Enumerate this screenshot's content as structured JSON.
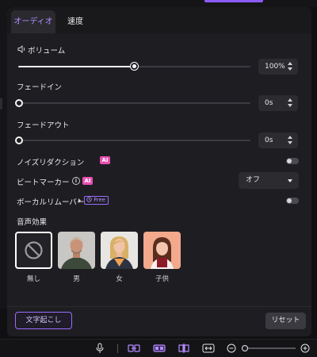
{
  "tabs": [
    {
      "label": "オーディオ",
      "active": true
    },
    {
      "label": "速度",
      "active": false
    }
  ],
  "volume": {
    "label": "ボリューム",
    "icon": "speaker-icon",
    "value": "100%",
    "level": 0.5
  },
  "fade_in": {
    "label": "フェードイン",
    "value": "0s",
    "level": 0.0
  },
  "fade_out": {
    "label": "フェードアウト",
    "value": "0s",
    "level": 0.0
  },
  "noise_reduction": {
    "label": "ノイズリダクション",
    "badge": "AI",
    "enabled": false
  },
  "beat_marker": {
    "label": "ビートマーカー",
    "badge": "AI",
    "info_icon": "info-icon",
    "select_value": "オフ"
  },
  "vocal_remover": {
    "label": "ボーカルリムーバー",
    "badge": "Free",
    "enabled": false
  },
  "voice_effects": {
    "title": "音声効果",
    "items": [
      {
        "label": "無し",
        "icon": "none-icon",
        "selected": true
      },
      {
        "label": "男",
        "icon": "man-portrait",
        "selected": false
      },
      {
        "label": "女",
        "icon": "woman-portrait",
        "selected": false
      },
      {
        "label": "子供",
        "icon": "child-portrait",
        "selected": false
      }
    ]
  },
  "footer": {
    "transcribe_label": "文字起こし",
    "reset_label": "リセット"
  },
  "bottom_toolbar": {
    "icons": [
      "microphone-icon",
      "link-clip-icon",
      "split-clip-icon",
      "trim-clip-icon",
      "fit-width-icon",
      "zoom-out-icon",
      "zoom-in-icon"
    ],
    "zoom_level": 0.0
  },
  "colors": {
    "accent": "#9b6cff",
    "ai_badge": "#e84fb0",
    "panel": "#1e1e22",
    "background": "#101012"
  }
}
